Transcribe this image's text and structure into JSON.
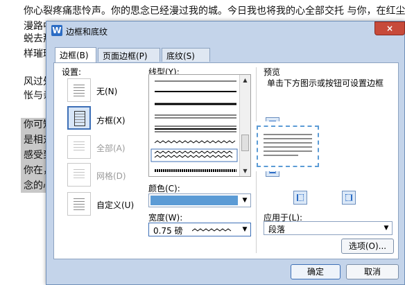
{
  "document": {
    "lines": [
      "你心裂疼痛悲怜声。你的思念已经漫过我的城。今日我也将我的心全部交托 与你，在红尘",
      "漫路中",
      "蜕去那",
      "样璀璨",
      "风过处",
      "怅与亲",
      "你可知",
      "是相对",
      "感受到",
      "你在，",
      "念的心"
    ]
  },
  "dialog": {
    "title": "边框和底纹",
    "app_icon": "W",
    "close_label": "×",
    "tabs": [
      "边框(B)",
      "页面边框(P)",
      "底纹(S)"
    ],
    "setting": {
      "label": "设置:",
      "items": [
        {
          "label": "无(N)",
          "icon": "none-border-icon",
          "selected": false,
          "disabled": false
        },
        {
          "label": "方框(X)",
          "icon": "box-border-icon",
          "selected": true,
          "disabled": false
        },
        {
          "label": "全部(A)",
          "icon": "all-border-icon",
          "selected": false,
          "disabled": true
        },
        {
          "label": "网格(D)",
          "icon": "grid-border-icon",
          "selected": false,
          "disabled": true
        },
        {
          "label": "自定义(U)",
          "icon": "custom-border-icon",
          "selected": false,
          "disabled": false
        }
      ]
    },
    "line_style": {
      "label": "线型(Y):"
    },
    "color": {
      "label": "颜色(C):",
      "value": "#5b9bd5"
    },
    "width": {
      "label": "宽度(W):",
      "value": "0.75 磅"
    },
    "preview": {
      "label": "预览",
      "hint": "单击下方图示或按钮可设置边框"
    },
    "apply_to": {
      "label": "应用于(L):",
      "value": "段落"
    },
    "options_button": "选项(O)...",
    "ok_button": "确定",
    "cancel_button": "取消"
  }
}
